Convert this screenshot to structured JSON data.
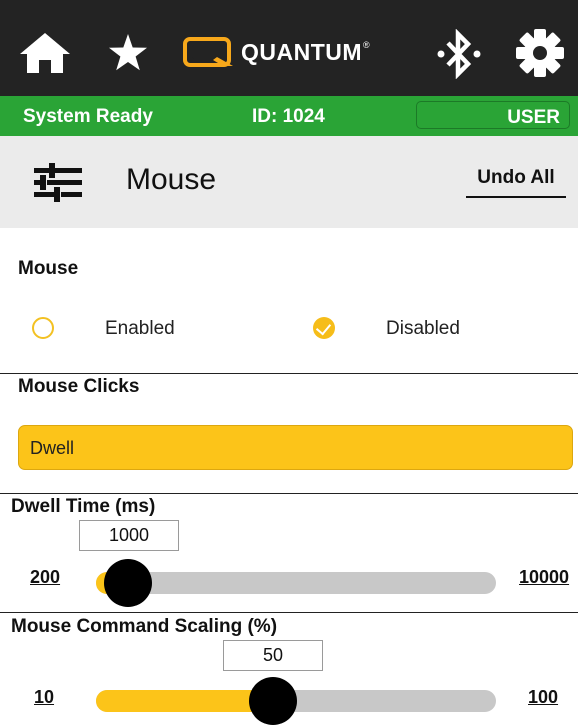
{
  "topbar": {
    "icons": [
      "home-icon",
      "star-icon",
      "bluetooth-icon",
      "gear-icon"
    ],
    "brand": "QUANTUM",
    "brand_mark": "®"
  },
  "status": {
    "state": "System Ready",
    "id": "ID: 1024",
    "user": "USER"
  },
  "header": {
    "title": "Mouse",
    "undo_label": "Undo All"
  },
  "mouse": {
    "label": "Mouse",
    "options": [
      {
        "label": "Enabled",
        "selected": false
      },
      {
        "label": "Disabled",
        "selected": true
      }
    ]
  },
  "mouse_clicks": {
    "label": "Mouse Clicks",
    "selected": "Dwell"
  },
  "dwell_time": {
    "label": "Dwell Time (ms)",
    "value": "1000",
    "min": "200",
    "max": "10000"
  },
  "scaling": {
    "label": "Mouse Command Scaling (%)",
    "value": "50",
    "min": "10",
    "max": "100"
  },
  "colors": {
    "topbar": "#232323",
    "status_green": "#2aa436",
    "accent_yellow": "#fcc419",
    "track_gray": "#c8c8c8",
    "header_gray": "#ebebeb"
  }
}
